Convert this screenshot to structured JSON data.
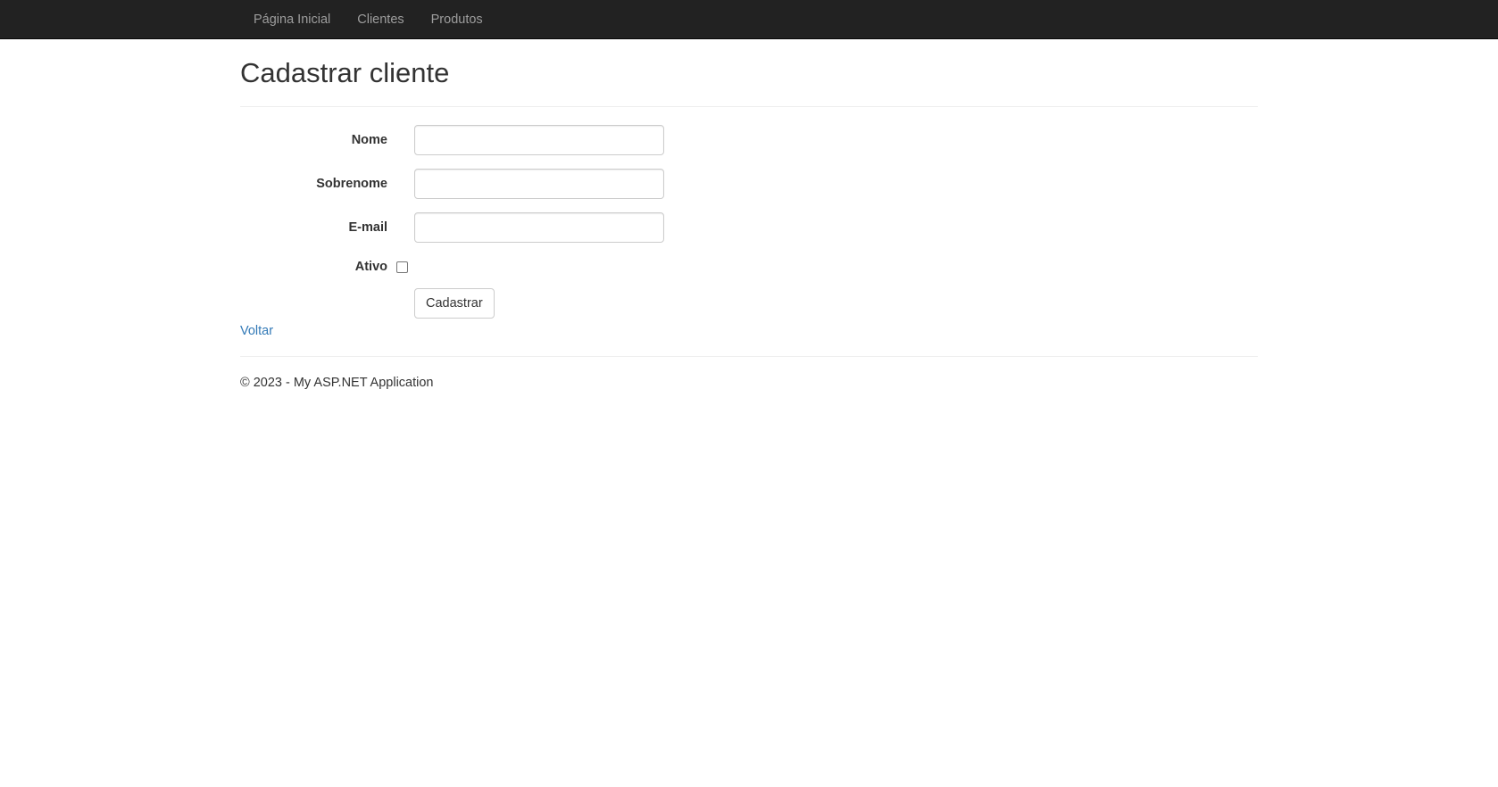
{
  "nav": {
    "items": [
      {
        "label": "Página Inicial"
      },
      {
        "label": "Clientes"
      },
      {
        "label": "Produtos"
      }
    ]
  },
  "page": {
    "title": "Cadastrar cliente"
  },
  "form": {
    "fields": [
      {
        "label": "Nome",
        "value": ""
      },
      {
        "label": "Sobrenome",
        "value": ""
      },
      {
        "label": "E-mail",
        "value": ""
      }
    ],
    "active_label": "Ativo",
    "active_checked": false,
    "submit_label": "Cadastrar"
  },
  "back_link": "Voltar",
  "footer": {
    "text": "© 2023 - My ASP.NET Application"
  },
  "colors": {
    "navbar_bg": "#222222",
    "nav_link": "#9d9d9d",
    "link": "#337ab7",
    "text": "#333333"
  }
}
